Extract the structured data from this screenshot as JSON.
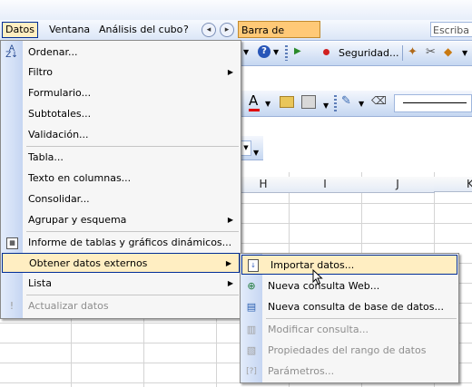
{
  "menubar": {
    "items": [
      "Datos",
      "Ventana",
      "Análisis del cubo",
      "?"
    ],
    "formula_bar_button": "Barra de fórmulas",
    "ask_box": "Escriba u"
  },
  "toolbar": {
    "security_label": "Seguridad...",
    "font_color_letter": "A",
    "cell_ref": "H",
    "icons": [
      "help-icon",
      "play-icon",
      "record-icon",
      "security-icon",
      "tools-icon",
      "shield-icon",
      "font-color-icon",
      "folder-icon",
      "chart-icon",
      "edit-icon",
      "eraser-icon"
    ]
  },
  "columns": [
    "H",
    "I",
    "J",
    "K"
  ],
  "datos_menu": {
    "items": [
      {
        "label": "Ordenar...",
        "icon": "sort-az-icon",
        "submenu": false,
        "disabled": false
      },
      {
        "label": "Filtro",
        "submenu": true,
        "disabled": false
      },
      {
        "label": "Formulario...",
        "submenu": false,
        "disabled": false
      },
      {
        "label": "Subtotales...",
        "submenu": false,
        "disabled": false
      },
      {
        "label": "Validación...",
        "submenu": false,
        "disabled": false
      },
      {
        "label": "Tabla...",
        "submenu": false,
        "disabled": false
      },
      {
        "label": "Texto en columnas...",
        "submenu": false,
        "disabled": false
      },
      {
        "label": "Consolidar...",
        "submenu": false,
        "disabled": false
      },
      {
        "label": "Agrupar y esquema",
        "submenu": true,
        "disabled": false
      },
      {
        "label": "Informe de tablas y gráficos dinámicos...",
        "icon": "pivot-table-icon",
        "submenu": false,
        "disabled": false
      },
      {
        "label": "Obtener datos externos",
        "submenu": true,
        "disabled": false,
        "highlighted": true
      },
      {
        "label": "Lista",
        "submenu": true,
        "disabled": false
      },
      {
        "label": "Actualizar datos",
        "icon": "refresh-icon",
        "submenu": false,
        "disabled": true
      }
    ]
  },
  "external_data_submenu": {
    "items": [
      {
        "label": "Importar datos...",
        "icon": "import-data-icon",
        "disabled": false,
        "highlighted": true
      },
      {
        "label": "Nueva consulta Web...",
        "icon": "web-query-icon",
        "disabled": false
      },
      {
        "label": "Nueva consulta de base de datos...",
        "icon": "database-query-icon",
        "disabled": false
      },
      {
        "label": "Modificar consulta...",
        "icon": "edit-query-icon",
        "disabled": true
      },
      {
        "label": "Propiedades del rango de datos",
        "icon": "properties-icon",
        "disabled": true
      },
      {
        "label": "Parámetros...",
        "icon": "parameters-icon",
        "disabled": true
      }
    ]
  }
}
